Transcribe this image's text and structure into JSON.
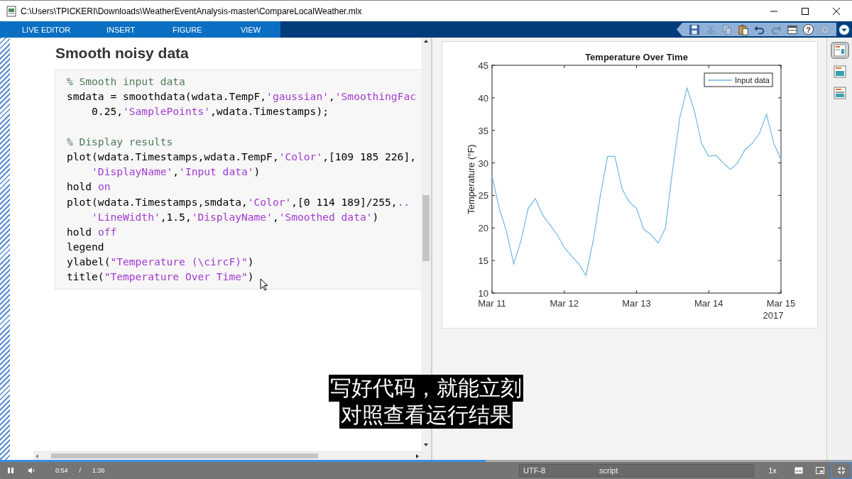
{
  "window": {
    "title": "C:\\Users\\TPICKERI\\Downloads\\WeatherEventAnalysis-master\\CompareLocalWeather.mlx"
  },
  "ribbon": {
    "tabs": [
      {
        "label": "LIVE EDITOR"
      },
      {
        "label": "INSERT"
      },
      {
        "label": "FIGURE"
      },
      {
        "label": "VIEW"
      }
    ],
    "toolbar": [
      {
        "kind": "save",
        "disabled": false
      },
      {
        "kind": "cut",
        "disabled": true
      },
      {
        "kind": "copy",
        "disabled": true
      },
      {
        "kind": "paste",
        "disabled": false
      },
      {
        "kind": "undo",
        "disabled": false
      },
      {
        "kind": "redo",
        "disabled": true
      },
      {
        "kind": "layout",
        "disabled": false
      },
      {
        "kind": "help",
        "label": "?",
        "disabled": false
      },
      {
        "kind": "dropdown",
        "disabled": true
      }
    ]
  },
  "editor": {
    "heading": "Smooth noisy data",
    "code_groups": [
      [
        [
          {
            "kind": "comment",
            "text": "% Smooth input data"
          }
        ],
        [
          {
            "kind": "text",
            "text": "smdata = smoothdata(wdata.TempF,"
          },
          {
            "kind": "string",
            "text": "'gaussian'"
          },
          {
            "kind": "text",
            "text": ","
          },
          {
            "kind": "string",
            "text": "'SmoothingFac"
          }
        ],
        [
          {
            "kind": "continued"
          },
          {
            "kind": "text",
            "text": "0.25,"
          },
          {
            "kind": "string",
            "text": "'SamplePoints'"
          },
          {
            "kind": "text",
            "text": ",wdata.Timestamps);"
          }
        ]
      ],
      [
        [
          {
            "kind": "comment",
            "text": "% Display results"
          }
        ],
        [
          {
            "kind": "text",
            "text": "plot(wdata.Timestamps,wdata.TempF,"
          },
          {
            "kind": "string",
            "text": "'Color'"
          },
          {
            "kind": "text",
            "text": ",[109 185 226],"
          }
        ],
        [
          {
            "kind": "continued"
          },
          {
            "kind": "string",
            "text": "'DisplayName'"
          },
          {
            "kind": "text",
            "text": ","
          },
          {
            "kind": "string",
            "text": "'Input data'"
          },
          {
            "kind": "text",
            "text": ")"
          }
        ],
        [
          {
            "kind": "text",
            "text": "hold "
          },
          {
            "kind": "keyword",
            "text": "on"
          }
        ],
        [
          {
            "kind": "text",
            "text": "plot(wdata.Timestamps,smdata,"
          },
          {
            "kind": "string",
            "text": "'Color'"
          },
          {
            "kind": "text",
            "text": ",[0 114 189]/255,"
          },
          {
            "kind": "keyword",
            "text": ".."
          }
        ],
        [
          {
            "kind": "continued"
          },
          {
            "kind": "string",
            "text": "'LineWidth'"
          },
          {
            "kind": "text",
            "text": ",1.5,"
          },
          {
            "kind": "string",
            "text": "'DisplayName'"
          },
          {
            "kind": "text",
            "text": ","
          },
          {
            "kind": "string",
            "text": "'Smoothed data'"
          },
          {
            "kind": "text",
            "text": ")"
          }
        ],
        [
          {
            "kind": "text",
            "text": "hold "
          },
          {
            "kind": "keyword",
            "text": "off"
          }
        ],
        [
          {
            "kind": "text",
            "text": "legend"
          }
        ],
        [
          {
            "kind": "text",
            "text": "ylabel("
          },
          {
            "kind": "string",
            "text": "\"Temperature (\\circF)\""
          },
          {
            "kind": "text",
            "text": ")"
          }
        ],
        [
          {
            "kind": "text",
            "text": "title("
          },
          {
            "kind": "string",
            "text": "\"Temperature Over Time\""
          },
          {
            "kind": "text",
            "text": ")"
          }
        ]
      ]
    ]
  },
  "figure": {
    "year_label": "2017",
    "chart_data": {
      "type": "line",
      "title": "Temperature Over Time",
      "ylabel": "Temperature (°F)",
      "categories": [
        "Mar 11",
        null,
        null,
        null,
        null,
        null,
        null,
        null,
        null,
        null,
        "Mar 12",
        null,
        null,
        null,
        null,
        null,
        null,
        null,
        null,
        null,
        "Mar 13",
        null,
        null,
        null,
        null,
        null,
        null,
        null,
        null,
        null,
        "Mar 14",
        null,
        null,
        null,
        null,
        null,
        null,
        null,
        null,
        null,
        "Mar 15"
      ],
      "series": [
        {
          "name": "Input data",
          "color": "#6db9e2",
          "values": [
            28,
            23,
            19.5,
            14.5,
            18,
            23,
            24.5,
            22,
            20.5,
            19,
            17,
            15.7,
            14.5,
            12.7,
            18,
            25,
            31,
            31,
            26,
            24,
            23,
            19.8,
            19,
            17.7,
            20,
            29,
            37,
            41.5,
            38,
            33,
            31,
            31.2,
            30,
            29,
            30,
            32,
            33,
            34.5,
            37.5,
            33,
            30.5
          ]
        }
      ],
      "ylim": [
        10,
        45
      ],
      "yticks": [
        10,
        15,
        20,
        25,
        30,
        35,
        40,
        45
      ]
    }
  },
  "side_buttons": [
    {
      "selected": true
    },
    {
      "selected": false
    },
    {
      "selected": false
    }
  ],
  "subtitles": [
    "写好代码，就能立刻",
    "对照查看运行结果"
  ],
  "player": {
    "playing": true,
    "current": "0:54",
    "separator": "/",
    "duration": "1:36",
    "progress": {
      "level": 0.57
    },
    "encoding": "UTF-8",
    "file_type": "script",
    "speed": "1x"
  }
}
